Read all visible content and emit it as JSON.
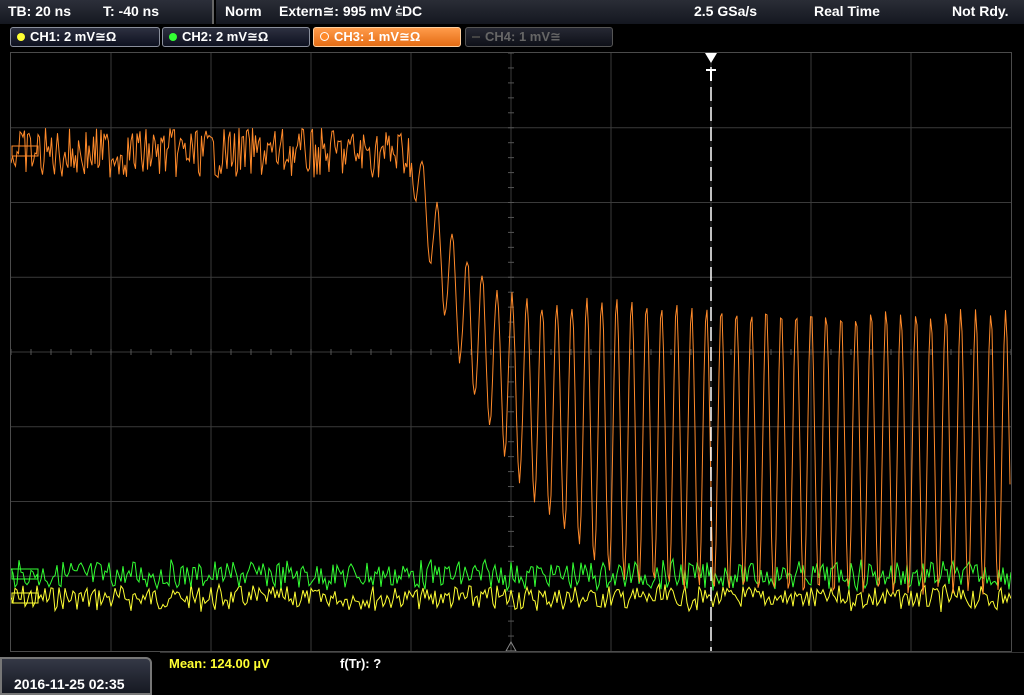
{
  "header": {
    "timebase": "TB: 20 ns",
    "trigger_offset": "T: -40 ns",
    "trigger_mode": "Norm",
    "trigger_source": "Extern≅: 995 mV ⫃DC",
    "sample_rate": "2.5 GSa/s",
    "acq_mode": "Real Time",
    "status": "Not Rdy."
  },
  "channels": [
    {
      "label": "CH1: 2 mV≅Ω",
      "color": "#ffff33"
    },
    {
      "label": "CH2: 2 mV≅Ω",
      "color": "#33ff33"
    },
    {
      "label": "CH3: 1 mV≅Ω",
      "color": "#ff8a2a"
    },
    {
      "label": "CH4: 1 mV≅",
      "color": "#666666"
    }
  ],
  "footer": {
    "datetime": "2016-11-25 02:35",
    "mean": "Mean: 124.00 µV",
    "ftr": "f(Tr): ?"
  },
  "colors": {
    "ch1": "#ffff33",
    "ch2": "#33ff33",
    "ch3": "#ff8a2a",
    "grid": "#3a3a3a"
  }
}
